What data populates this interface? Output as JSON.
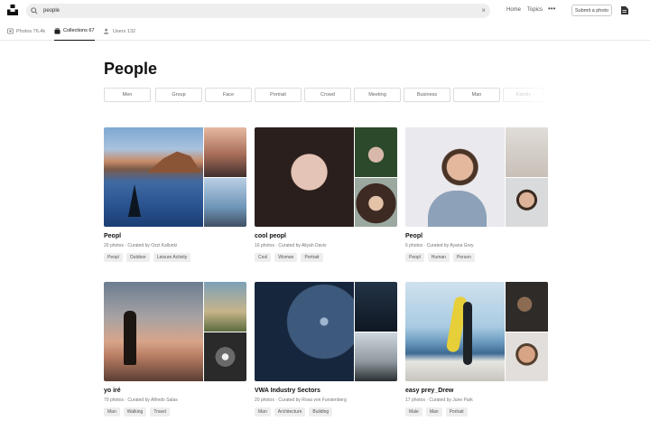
{
  "search": {
    "value": "people"
  },
  "nav": {
    "home": "Home",
    "topics": "Topics",
    "more": "•••",
    "submit": "Submit a photo"
  },
  "tabs": [
    {
      "label": "Photos 76.4k"
    },
    {
      "label": "Collections 67"
    },
    {
      "label": "Users 132"
    }
  ],
  "page": {
    "title": "People"
  },
  "chips": [
    "Men",
    "Group",
    "Face",
    "Portrait",
    "Crowd",
    "Meeting",
    "Business",
    "Man",
    "Family"
  ],
  "cards": [
    {
      "title": "Peopl",
      "meta": "20 photos · Curated by Ozzi Kallunki",
      "tags": [
        "Peopl",
        "Outdoor",
        "Leisure Activity"
      ]
    },
    {
      "title": "cool peopl",
      "meta": "16 photos · Curated by Aliyah Davis",
      "tags": [
        "Cool",
        "Woman",
        "Portrait"
      ]
    },
    {
      "title": "Peopl",
      "meta": "6 photos · Curated by Ayana Grey",
      "tags": [
        "Peopl",
        "Human",
        "Person"
      ]
    },
    {
      "title": "yo iré",
      "meta": "79 photos · Curated by Alfredo Salas",
      "tags": [
        "Man",
        "Walking",
        "Travel"
      ]
    },
    {
      "title": "VWA Industry Sectors",
      "meta": "20 photos · Curated by Rosa von Furstenberg",
      "tags": [
        "Man",
        "Architecture",
        "Building"
      ]
    },
    {
      "title": "easy prey_Drew",
      "meta": "17 photos · Curated by June Park",
      "tags": [
        "Male",
        "Man",
        "Portrait"
      ]
    }
  ]
}
